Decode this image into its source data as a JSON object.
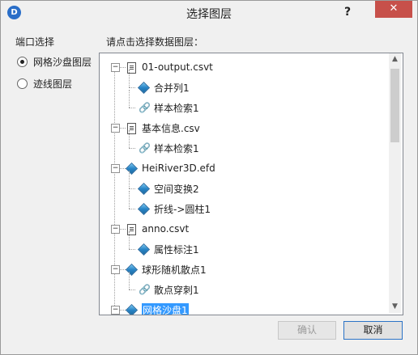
{
  "window": {
    "title": "选择图层",
    "icon_letter": "D",
    "help": "?",
    "close": "✕"
  },
  "left_panel": {
    "label": "端口选择",
    "options": [
      {
        "label": "网格沙盘图层",
        "checked": true
      },
      {
        "label": "迹线图层",
        "checked": false
      }
    ]
  },
  "right_panel": {
    "label": "请点击选择数据图层："
  },
  "tree": [
    {
      "label": "01-output.csvt",
      "icon": "file",
      "level": 0,
      "expanded": true
    },
    {
      "label": "合并列1",
      "icon": "cube",
      "level": 1
    },
    {
      "label": "样本检索1",
      "icon": "link",
      "level": 1
    },
    {
      "label": "基本信息.csv",
      "icon": "file",
      "level": 0,
      "expanded": true
    },
    {
      "label": "样本检索1",
      "icon": "link",
      "level": 1
    },
    {
      "label": "HeiRiver3D.efd",
      "icon": "cube",
      "level": 0,
      "expanded": true
    },
    {
      "label": "空间变换2",
      "icon": "cube",
      "level": 1
    },
    {
      "label": "折线->圆柱1",
      "icon": "cube",
      "level": 1
    },
    {
      "label": "anno.csvt",
      "icon": "file",
      "level": 0,
      "expanded": true
    },
    {
      "label": "属性标注1",
      "icon": "cube",
      "level": 1
    },
    {
      "label": "球形随机散点1",
      "icon": "cube",
      "level": 0,
      "expanded": true
    },
    {
      "label": "散点穿刺1",
      "icon": "link",
      "level": 1
    },
    {
      "label": "网格沙盘1",
      "icon": "cube",
      "level": 0,
      "expanded": true,
      "selected": true
    }
  ],
  "buttons": {
    "ok": "确认",
    "cancel": "取消"
  }
}
